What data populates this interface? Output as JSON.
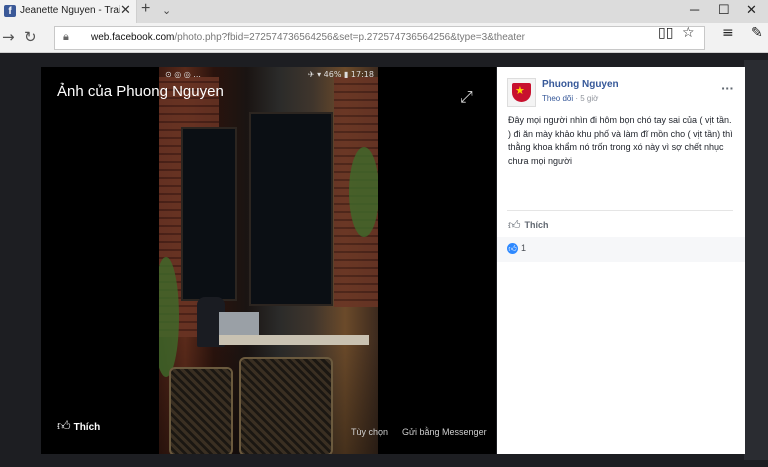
{
  "browser": {
    "tab_title": "Jeanette Nguyen - Trai ",
    "tab_close": "✕",
    "new_tab": "+",
    "tab_menu": "⌄",
    "min": "─",
    "max": "☐",
    "close": "✕",
    "url_host": "web.facebook.com",
    "url_path": "/photo.php?fbid=272574736564256&set=p.272574736564256&type=3&theater"
  },
  "viewer": {
    "title": "Ảnh của Phuong Nguyen",
    "like_label": "Thích",
    "options_label": "Tùy chọn",
    "send_label": "Gửi bằng Messenger",
    "phone_status_left": "⊙ ◎ ◎ ...",
    "phone_status_right": "✈ ▾ 46% ▮ 17:18"
  },
  "post": {
    "author": "Phuong Nguyen",
    "follow": "Theo dõi",
    "time": "5 giờ",
    "text": "Đây mọi người nhìn đi hôm bọn chó tay sai của ( vịt tần. ) đi ăn mày khảo khu phố và làm đĩ mồn cho ( vịt tần) thì thằng khoa khẩm nó trốn trong xó này vì sợ chết nhục chưa mọi người",
    "like_label": "Thích",
    "reaction_count": "1"
  },
  "colors": {
    "fb_blue": "#365899",
    "like_blue": "#2e89ff"
  }
}
